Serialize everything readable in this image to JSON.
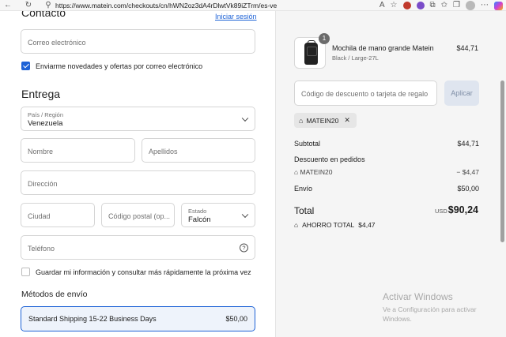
{
  "browser": {
    "url": "https://www.matein.com/checkouts/cn/hWN2oz3dA4rDlwtVk89iZTrm/es-ve"
  },
  "contact": {
    "title": "Contacto",
    "login_link": "Iniciar sesión",
    "email_placeholder": "Correo electrónico",
    "newsletter_label": "Enviarme novedades y ofertas por correo electrónico",
    "newsletter_checked": true
  },
  "delivery": {
    "title": "Entrega",
    "country_label": "País / Región",
    "country_value": "Venezuela",
    "first_name_placeholder": "Nombre",
    "last_name_placeholder": "Apellidos",
    "address_placeholder": "Dirección",
    "city_placeholder": "Ciudad",
    "postal_placeholder": "Código postal (op...",
    "state_label": "Estado",
    "state_value": "Falcón",
    "phone_placeholder": "Teléfono",
    "save_info_label": "Guardar mi información y consultar más rápidamente la próxima vez",
    "save_info_checked": false
  },
  "shipping": {
    "title": "Métodos de envío",
    "option_name": "Standard Shipping 15-22 Business Days",
    "option_price": "$50,00"
  },
  "summary": {
    "product": {
      "quantity": "1",
      "name": "Mochila de mano grande Matein",
      "variant": "Black / Large-27L",
      "price": "$44,71"
    },
    "discount_placeholder": "Código de descuento o tarjeta de regalo",
    "apply_label": "Aplicar",
    "applied_code": "MATEIN20",
    "subtotal_label": "Subtotal",
    "subtotal_value": "$44,71",
    "order_discount_label": "Descuento en pedidos",
    "order_discount_code": "MATEIN20",
    "order_discount_value": "− $4,47",
    "shipping_label": "Envío",
    "shipping_value": "$50,00",
    "total_label": "Total",
    "total_currency": "USD",
    "total_value": "$90,24",
    "saving_label": "AHORRO TOTAL",
    "saving_value": "$4,47"
  },
  "watermark": {
    "title": "Activar Windows",
    "subtitle": "Ve a Configuración para activar Windows."
  }
}
